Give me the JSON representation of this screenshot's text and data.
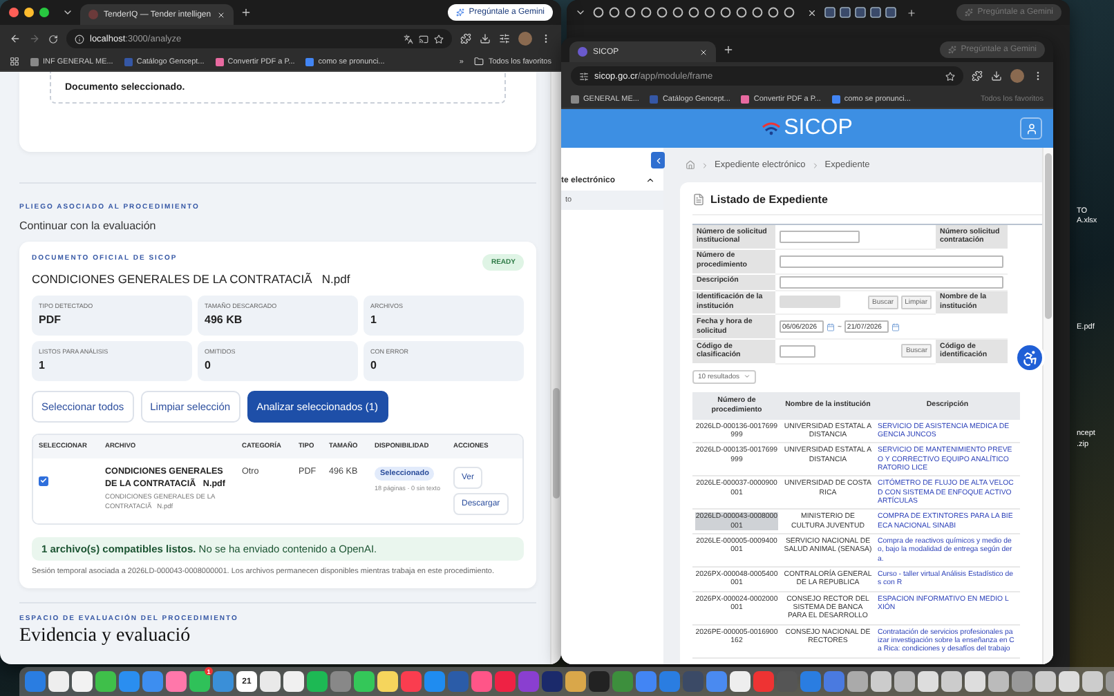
{
  "left_window": {
    "tab_title": "TenderIQ — Tender intelligen",
    "gemini": "Pregúntale a Gemini",
    "url_host": "localhost",
    "url_path": ":3000/analyze",
    "bookmarks": [
      "INF GENERAL ME...",
      "Catálogo Gencept...",
      "Convertir PDF a P...",
      "como se pronunci..."
    ],
    "bookmarks_more": "»",
    "all_bookmarks": "Todos los favoritos"
  },
  "analyze_page": {
    "selected_notice": "Documento seleccionado.",
    "section_eyebrow": "PLIEGO ASOCIADO AL PROCEDIMIENTO",
    "section_subtitle": "Continuar con la evaluación",
    "document": {
      "eyebrow": "DOCUMENTO OFICIAL DE SICOP",
      "title": "CONDICIONES GENERALES DE LA CONTRATACIÃ   N.pdf",
      "status": "READY"
    },
    "stats": [
      {
        "label": "TIPO DETECTADO",
        "value": "PDF"
      },
      {
        "label": "TAMAÑO DESCARGADO",
        "value": "496 KB"
      },
      {
        "label": "ARCHIVOS",
        "value": "1"
      },
      {
        "label": "LISTOS PARA ANÁLISIS",
        "value": "1"
      },
      {
        "label": "OMITIDOS",
        "value": "0"
      },
      {
        "label": "CON ERROR",
        "value": "0"
      }
    ],
    "buttons": [
      {
        "label": "Seleccionar todos",
        "kind": "secondary"
      },
      {
        "label": "Limpiar selección",
        "kind": "secondary"
      },
      {
        "label": "Analizar seleccionados (1)",
        "kind": "primary"
      }
    ],
    "files_table": {
      "columns": [
        "SELECCIONAR",
        "ARCHIVO",
        "CATEGORÍA",
        "TIPO",
        "TAMAÑO",
        "DISPONIBILIDAD",
        "ACCIONES"
      ],
      "rows": [
        {
          "checked": true,
          "file_name": "CONDICIONES GENERALES DE LA CONTRATACIÃ   N.pdf",
          "file_path": "CONDICIONES GENERALES DE LA CONTRATACIÃ   N.pdf",
          "category": "Otro",
          "type": "PDF",
          "size": "496 KB",
          "availability": "Seleccionado",
          "availability_note": "18 páginas · 0 sin texto",
          "actions": [
            "Ver",
            "Descargar"
          ]
        }
      ]
    },
    "notice": "**1 archivo(s) compatibles listos.** No se ha enviado contenido a OpenAI.",
    "session_note": "Sesión temporal asociada a 2026LD-000043-0008000001. Los archivos permanecen disponibles mientras trabaja en este procedimiento.",
    "next_eyebrow": "ESPACIO DE EVALUACIÓN DEL PROCEDIMIENTO",
    "next_title": "Evidencia y evaluació"
  },
  "right_window": {
    "background_gemini": "Pregúntale a Gemini",
    "tab_title": "SICOP",
    "gemini": "Pregúntale a Gemini",
    "url_host": "sicop.go.cr",
    "url_path": "/app/module/frame",
    "bookmarks": [
      "GENERAL ME...",
      "Catálogo Gencept...",
      "Convertir PDF a P...",
      "como se pronunci..."
    ],
    "all_bookmarks": "Todos los favoritos",
    "logo": "SICOP",
    "sidebar": {
      "section": "te electrónico",
      "expanded": true,
      "items": [
        {
          "label": "to",
          "selected": true
        }
      ]
    },
    "breadcrumb": [
      "Expediente electrónico",
      "Expediente"
    ],
    "panel_title": "Listado de Expediente",
    "form_rows": [
      {
        "kind": "short",
        "label": "Número de solicitud institucional",
        "side_label": "Número solicitud contratación"
      },
      {
        "kind": "wide",
        "label": "Número de procedimiento"
      },
      {
        "kind": "wide",
        "label": "Descripción"
      },
      {
        "kind": "lookup",
        "label": "Identificación de la institución",
        "input_disabled": true,
        "buttons": [
          "Buscar",
          "Limpiar"
        ],
        "side_label": "Nombre de la institución"
      },
      {
        "kind": "date_range",
        "label": "Fecha y hora de solicitud",
        "from": "06/06/2026",
        "separator": "~",
        "to": "21/07/2026"
      },
      {
        "kind": "lookup",
        "label": "Código de clasificación",
        "input_disabled": false,
        "buttons": [
          "Buscar"
        ],
        "side_label": "Código de identificación"
      }
    ],
    "page_size": "10 resultados",
    "results": {
      "columns": [
        "Número de procedimiento",
        "Nombre de la institución",
        "Descripción"
      ],
      "rows": [
        {
          "number": "2026LD-000136-0017699999",
          "institution": "UNIVERSIDAD ESTATAL A DISTANCIA",
          "description": "SERVICIO DE ASISTENCIA MEDICA DE\nGENCIA JUNCOS",
          "selected": false
        },
        {
          "number": "2026LD-000135-0017699999",
          "institution": "UNIVERSIDAD ESTATAL A DISTANCIA",
          "description": "SERVICIO DE MANTENIMIENTO PREVE\nO Y CORRECTIVO EQUIPO ANALÍTICO\nRATORIO LICE",
          "selected": false
        },
        {
          "number": "2026LE-000037-0000900001",
          "institution": "UNIVERSIDAD DE COSTA RICA",
          "description": "CITÓMETRO DE FLUJO DE ALTA VELOC\nD CON SISTEMA DE ENFOQUE ACTIVO\nARTÍCULAS",
          "selected": false
        },
        {
          "number": "2026LD-000043-0008000001",
          "institution": "MINISTERIO DE CULTURA JUVENTUD",
          "description": "COMPRA DE EXTINTORES PARA LA BIE\nECA NACIONAL SINABI",
          "selected": true
        },
        {
          "number": "2026LE-000005-0009400001",
          "institution": "SERVICIO NACIONAL DE SALUD ANIMAL (SENASA)",
          "description": "Compra de reactivos químicos y medio de\no, bajo la modalidad de entrega según der\na.",
          "selected": false
        },
        {
          "number": "2026PX-000048-0005400001",
          "institution": "CONTRALORÍA GENERAL DE LA REPUBLICA",
          "description": "Curso - taller virtual Análisis Estadístico de\ns con R",
          "selected": false
        },
        {
          "number": "2026PX-000024-0002000001",
          "institution": "CONSEJO RECTOR DEL SISTEMA DE BANCA PARA EL DESARROLLO",
          "description": "ESPACION INFORMATIVO EN MEDIO L\nXIÓN",
          "selected": false
        },
        {
          "number": "2026PE-000005-0016900162",
          "institution": "CONSEJO NACIONAL DE RECTORES",
          "description": "Contratación de servicios profesionales pa\nizar investigación sobre la enseñanza en C\na Rica: condiciones y desafíos del trabajo",
          "selected": false
        }
      ]
    }
  },
  "desktop": {
    "files": [
      "TO\nA.xlsx",
      "E.pdf",
      "ncept\n.zip"
    ]
  },
  "dock": {
    "calendar_day": "21",
    "badge": "1"
  }
}
